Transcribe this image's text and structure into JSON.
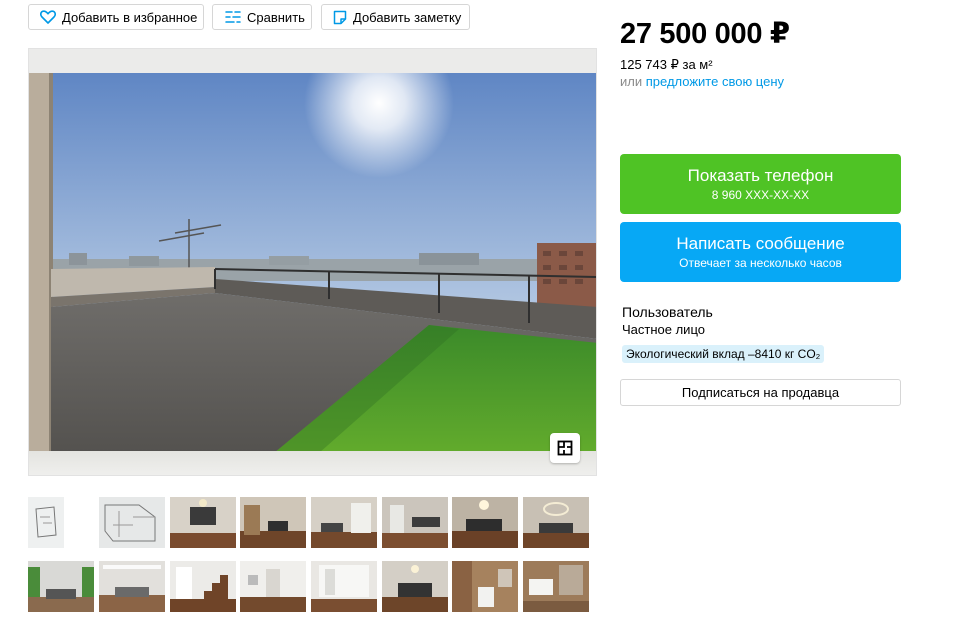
{
  "actions": {
    "favorite_label": "Добавить в избранное",
    "compare_label": "Сравнить",
    "note_label": "Добавить заметку"
  },
  "listing": {
    "price": "27 500 000 ₽",
    "price_per_m2": "125 743 ₽ за м²",
    "offer_prefix": "или",
    "offer_link": "предложите свою цену"
  },
  "contact": {
    "phone_label": "Показать телефон",
    "phone_masked": "8 960 XXX-XX-XX",
    "message_label": "Написать сообщение",
    "message_sub": "Отвечает за несколько часов"
  },
  "seller": {
    "name": "Пользователь",
    "type": "Частное лицо",
    "eco_badge": "Экологический вклад –8410 кг CO₂",
    "subscribe_label": "Подписаться на продавца"
  },
  "colors": {
    "phone_button": "#4fc325",
    "message_button": "#07a8f5",
    "link": "#0099e6",
    "eco_badge_bg": "#daf1fb"
  },
  "icons": {
    "favorite": "heart-icon",
    "compare": "compare-list-icon",
    "note": "note-icon",
    "floor_plan": "floor-plan-icon"
  }
}
